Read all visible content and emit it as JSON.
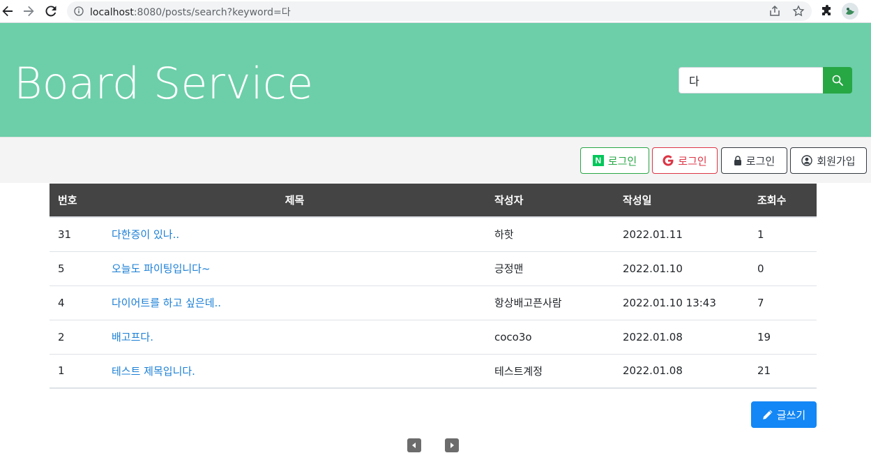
{
  "browser": {
    "url_host": "localhost",
    "url_path": ":8080/posts/search?keyword=다"
  },
  "header": {
    "title": "Board Service",
    "search_value": "다"
  },
  "auth": {
    "naver_login": "로그인",
    "google_login": "로그인",
    "local_login": "로그인",
    "signup": "회원가입"
  },
  "table": {
    "columns": [
      "번호",
      "제목",
      "작성자",
      "작성일",
      "조회수"
    ],
    "rows": [
      {
        "no": "31",
        "title": "다한증이 있나..",
        "author": "하핫",
        "date": "2022.01.11",
        "views": "1"
      },
      {
        "no": "5",
        "title": "오늘도 파이팅입니다~",
        "author": "긍정맨",
        "date": "2022.01.10",
        "views": "0"
      },
      {
        "no": "4",
        "title": "다이어트를 하고 싶은데..",
        "author": "항상배고픈사람",
        "date": "2022.01.10 13:43",
        "views": "7"
      },
      {
        "no": "2",
        "title": "배고프다.",
        "author": "coco3o",
        "date": "2022.01.08",
        "views": "19"
      },
      {
        "no": "1",
        "title": "테스트 제목입니다.",
        "author": "테스트계정",
        "date": "2022.01.08",
        "views": "21"
      }
    ]
  },
  "actions": {
    "write_label": "글쓰기"
  },
  "colors": {
    "header_bg": "#6ccfa9",
    "search_button": "#28a745",
    "table_header": "#444444",
    "link": "#1a7fd6",
    "write_button": "#1387f5"
  }
}
